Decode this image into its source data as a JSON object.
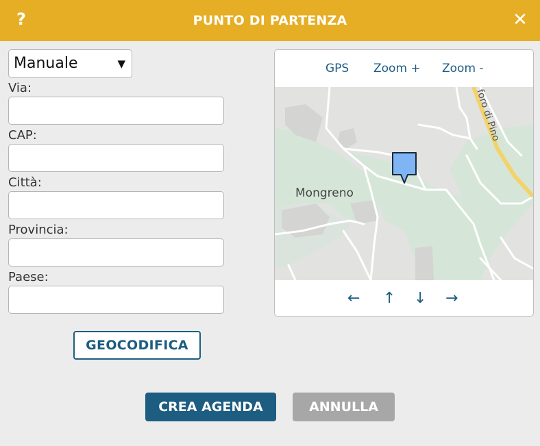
{
  "dialog": {
    "title": "PUNTO DI PARTENZA",
    "help_icon": "?",
    "close_icon": "✕"
  },
  "form": {
    "mode_select": {
      "selected": "Manuale",
      "caret": "▼"
    },
    "fields": [
      {
        "label": "Via:",
        "value": ""
      },
      {
        "label": "CAP:",
        "value": ""
      },
      {
        "label": "Città:",
        "value": ""
      },
      {
        "label": "Provincia:",
        "value": ""
      },
      {
        "label": "Paese:",
        "value": ""
      }
    ],
    "geocode_button": "GEOCODIFICA"
  },
  "map": {
    "controls": {
      "gps": "GPS",
      "zoom_in": "Zoom +",
      "zoom_out": "Zoom -"
    },
    "place_label": "Mongreno",
    "road_label": "foro di Pino",
    "nav": {
      "left": "←",
      "up": "↑",
      "down": "↓",
      "right": "→"
    },
    "colors": {
      "green": "#d7e8dc",
      "grey": "#e2e2e0",
      "road": "#ffffff",
      "highway": "#f2d36b",
      "marker": "#7fb4f5"
    }
  },
  "actions": {
    "create": "CREA AGENDA",
    "cancel": "ANNULLA"
  },
  "colors": {
    "header": "#e6ae25",
    "primary": "#1d5d82",
    "secondary": "#a7a7a7"
  }
}
